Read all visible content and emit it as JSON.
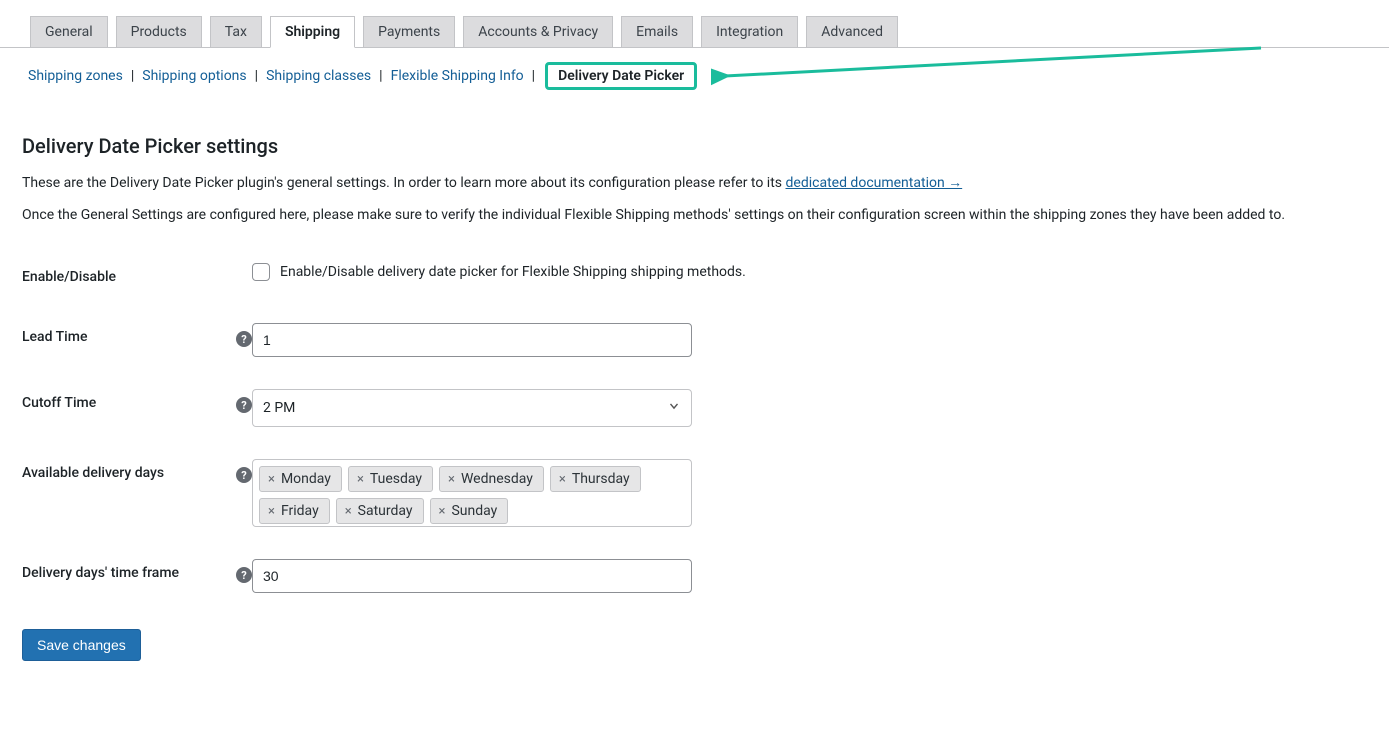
{
  "tabs": {
    "items": [
      {
        "label": "General",
        "active": false
      },
      {
        "label": "Products",
        "active": false
      },
      {
        "label": "Tax",
        "active": false
      },
      {
        "label": "Shipping",
        "active": true
      },
      {
        "label": "Payments",
        "active": false
      },
      {
        "label": "Accounts & Privacy",
        "active": false
      },
      {
        "label": "Emails",
        "active": false
      },
      {
        "label": "Integration",
        "active": false
      },
      {
        "label": "Advanced",
        "active": false
      }
    ]
  },
  "subtabs": {
    "items": [
      {
        "label": "Shipping zones",
        "active": false
      },
      {
        "label": "Shipping options",
        "active": false
      },
      {
        "label": "Shipping classes",
        "active": false
      },
      {
        "label": "Flexible Shipping Info",
        "active": false
      },
      {
        "label": "Delivery Date Picker",
        "active": true
      }
    ]
  },
  "page": {
    "title": "Delivery Date Picker settings",
    "intro": "These are the Delivery Date Picker plugin's general settings. In order to learn more about its configuration please refer to its ",
    "doc_link_label": "dedicated documentation →",
    "note": "Once the General Settings are configured here, please make sure to verify the individual Flexible Shipping methods' settings on their configuration screen within the shipping zones they have been added to."
  },
  "form": {
    "enable": {
      "label": "Enable/Disable",
      "checkbox_label": "Enable/Disable delivery date picker for Flexible Shipping shipping methods.",
      "checked": false
    },
    "lead_time": {
      "label": "Lead Time",
      "value": "1"
    },
    "cutoff_time": {
      "label": "Cutoff Time",
      "value": "2 PM"
    },
    "available_days": {
      "label": "Available delivery days",
      "items": [
        "Monday",
        "Tuesday",
        "Wednesday",
        "Thursday",
        "Friday",
        "Saturday",
        "Sunday"
      ]
    },
    "time_frame": {
      "label": "Delivery days' time frame",
      "value": "30"
    },
    "save_label": "Save changes",
    "help_glyph": "?"
  },
  "colors": {
    "highlight": "#1abc9c",
    "primary": "#2271b1"
  }
}
